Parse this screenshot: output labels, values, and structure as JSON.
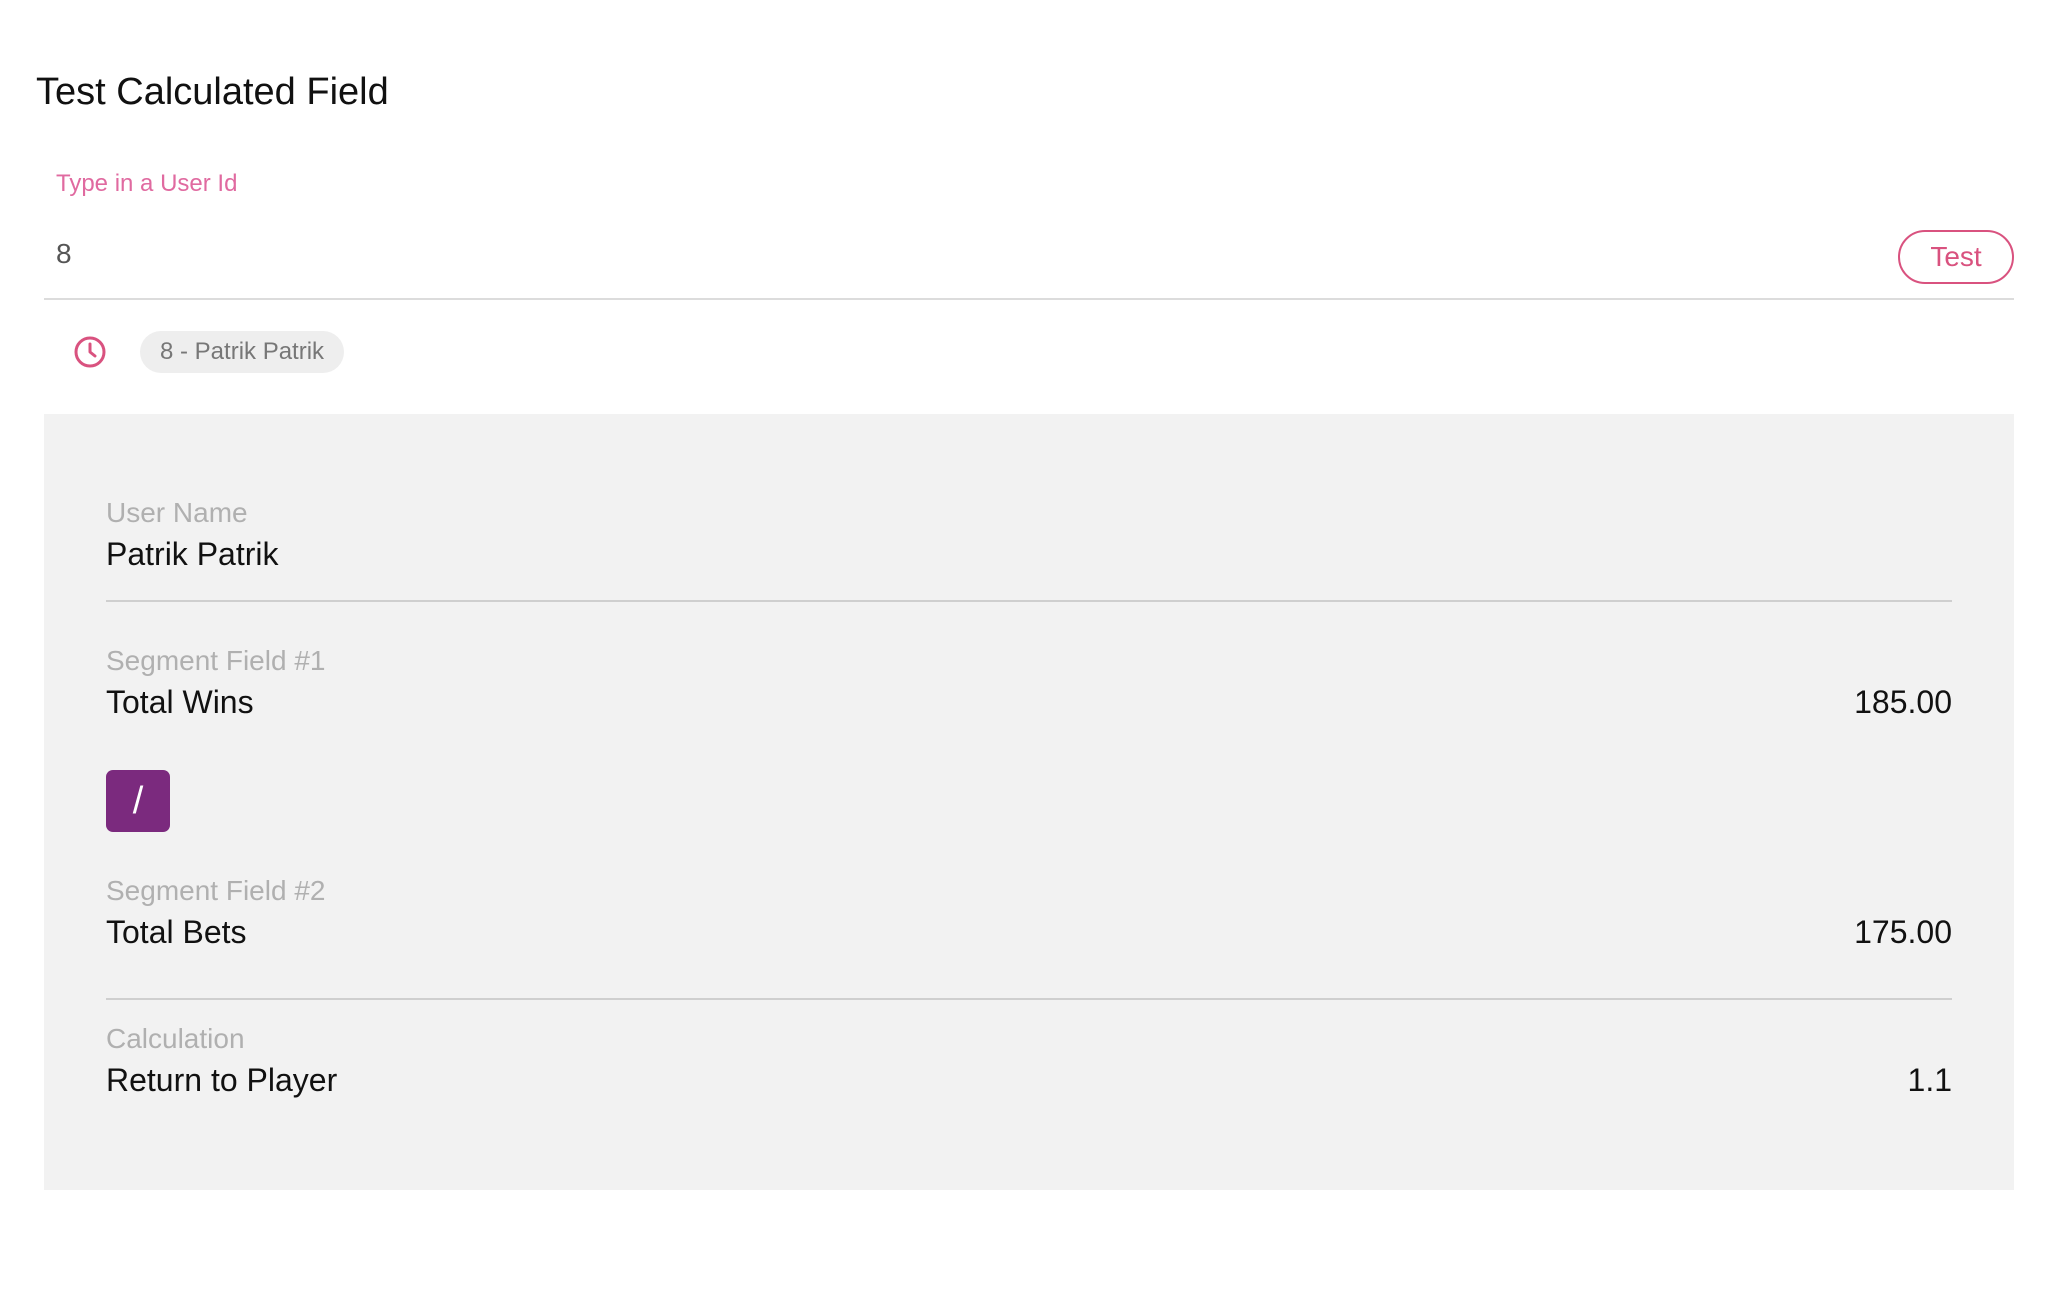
{
  "page": {
    "title": "Test Calculated Field"
  },
  "user_input": {
    "label": "Type in a User Id",
    "value": "8",
    "test_button_label": "Test"
  },
  "history": {
    "icon": "clock-icon",
    "chip_label": "8 - Patrik Patrik"
  },
  "result": {
    "user_name": {
      "label": "User Name",
      "value": "Patrik Patrik"
    },
    "segment_field_1": {
      "label": "Segment Field #1",
      "name": "Total Wins",
      "value": "185.00"
    },
    "operator": "/",
    "segment_field_2": {
      "label": "Segment Field #2",
      "name": "Total Bets",
      "value": "175.00"
    },
    "calculation": {
      "label": "Calculation",
      "name": "Return to Player",
      "value": "1.1"
    }
  },
  "colors": {
    "accent": "#d9527f",
    "label_accent": "#e06aa0",
    "operator_bg": "#7b2a7e",
    "panel_bg": "#f2f2f2"
  }
}
